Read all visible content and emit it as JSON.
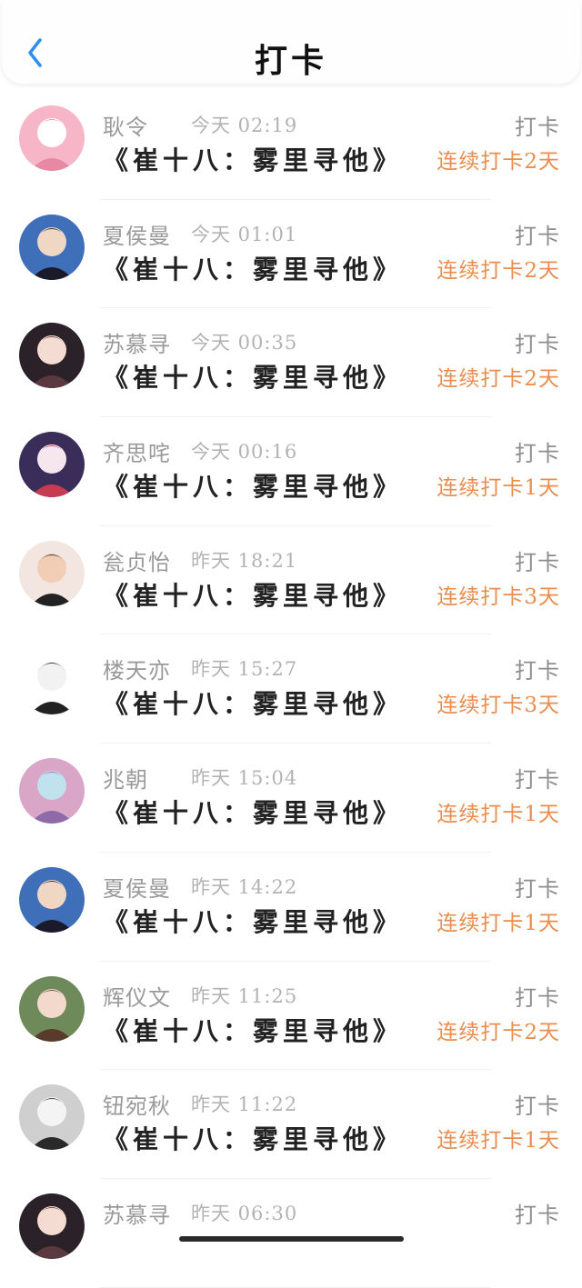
{
  "header": {
    "title": "打卡",
    "back_icon": "chevron-left-icon",
    "back_color": "#2b8ff5"
  },
  "colors": {
    "name": "#9a9a9a",
    "time": "#b3b3b3",
    "book": "#222222",
    "action": "#8d8d8d",
    "streak": "#ea8d4e"
  },
  "rows": [
    {
      "name": "耿令",
      "time": "今天 02:19",
      "book": "《崔十八：雾里寻他》",
      "action": "打卡",
      "streak": "连续打卡2天",
      "avatar": [
        "#f7b6c8",
        "#ffffff",
        "#e889a4"
      ]
    },
    {
      "name": "夏侯曼",
      "time": "今天 01:01",
      "book": "《崔十八：雾里寻他》",
      "action": "打卡",
      "streak": "连续打卡2天",
      "avatar": [
        "#3f6fb8",
        "#f0d7c4",
        "#1a1a2a"
      ]
    },
    {
      "name": "苏慕寻",
      "time": "今天 00:35",
      "book": "《崔十八：雾里寻他》",
      "action": "打卡",
      "streak": "连续打卡2天",
      "avatar": [
        "#2a2228",
        "#f4dcd2",
        "#5a3a40"
      ]
    },
    {
      "name": "齐思咤",
      "time": "今天 00:16",
      "book": "《崔十八：雾里寻他》",
      "action": "打卡",
      "streak": "连续打卡1天",
      "avatar": [
        "#3a2d5a",
        "#f6e6ee",
        "#c63a52"
      ]
    },
    {
      "name": "瓮贞怡",
      "time": "昨天 18:21",
      "book": "《崔十八：雾里寻他》",
      "action": "打卡",
      "streak": "连续打卡3天",
      "avatar": [
        "#f3e6e0",
        "#f1cdb6",
        "#222222"
      ]
    },
    {
      "name": "楼天亦",
      "time": "昨天 15:27",
      "book": "《崔十八：雾里寻他》",
      "action": "打卡",
      "streak": "连续打卡3天",
      "avatar": [
        "#ffffff",
        "#f2f2f2",
        "#222222"
      ]
    },
    {
      "name": "兆朝",
      "time": "昨天 15:04",
      "book": "《崔十八：雾里寻他》",
      "action": "打卡",
      "streak": "连续打卡1天",
      "avatar": [
        "#d9a6c8",
        "#bfe2ee",
        "#8e6aa8"
      ]
    },
    {
      "name": "夏侯曼",
      "time": "昨天 14:22",
      "book": "《崔十八：雾里寻他》",
      "action": "打卡",
      "streak": "连续打卡1天",
      "avatar": [
        "#3f6fb8",
        "#f0d7c4",
        "#1a1a2a"
      ]
    },
    {
      "name": "辉仪文",
      "time": "昨天 11:25",
      "book": "《崔十八：雾里寻他》",
      "action": "打卡",
      "streak": "连续打卡2天",
      "avatar": [
        "#6f8a5a",
        "#f3d9cb",
        "#5a3a2a"
      ]
    },
    {
      "name": "钮宛秋",
      "time": "昨天 11:22",
      "book": "《崔十八：雾里寻他》",
      "action": "打卡",
      "streak": "连续打卡1天",
      "avatar": [
        "#cfcfcf",
        "#f4f4f4",
        "#2a2a2a"
      ]
    },
    {
      "name": "苏慕寻",
      "time": "昨天 06:30",
      "book": "",
      "action": "打卡",
      "streak": "",
      "avatar": [
        "#2a2228",
        "#f4dcd2",
        "#5a3a40"
      ]
    }
  ]
}
